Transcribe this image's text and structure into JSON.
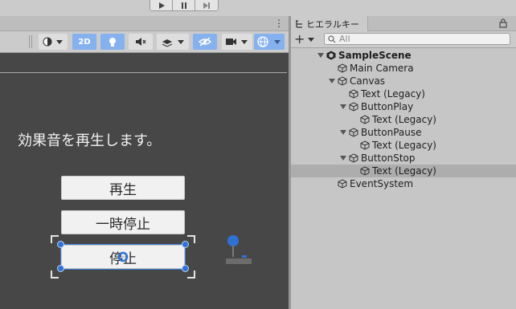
{
  "playbar": {
    "buttons": [
      "play-icon",
      "pause-icon",
      "step-icon"
    ]
  },
  "scene": {
    "toolbar": {
      "mode_2d": "2D"
    },
    "canvas_text": "効果音を再生します。",
    "buttons": [
      {
        "label": "再生"
      },
      {
        "label": "一時停止"
      },
      {
        "label": "停止"
      }
    ]
  },
  "hierarchy": {
    "tab_label": "ヒエラルキー",
    "search_placeholder": "All",
    "items": [
      {
        "label": "SampleScene",
        "depth": 0,
        "expanded": true,
        "bold": true,
        "icon": "unity-scene-icon"
      },
      {
        "label": "Main Camera",
        "depth": 1,
        "expanded": null,
        "icon": "gameobject-icon"
      },
      {
        "label": "Canvas",
        "depth": 1,
        "expanded": true,
        "icon": "gameobject-icon"
      },
      {
        "label": "Text (Legacy)",
        "depth": 2,
        "expanded": null,
        "icon": "gameobject-icon"
      },
      {
        "label": "ButtonPlay",
        "depth": 2,
        "expanded": true,
        "icon": "gameobject-icon"
      },
      {
        "label": "Text (Legacy)",
        "depth": 3,
        "expanded": null,
        "icon": "gameobject-icon"
      },
      {
        "label": "ButtonPause",
        "depth": 2,
        "expanded": true,
        "icon": "gameobject-icon"
      },
      {
        "label": "Text (Legacy)",
        "depth": 3,
        "expanded": null,
        "icon": "gameobject-icon"
      },
      {
        "label": "ButtonStop",
        "depth": 2,
        "expanded": true,
        "icon": "gameobject-icon"
      },
      {
        "label": "Text (Legacy)",
        "depth": 3,
        "expanded": null,
        "selected": true,
        "icon": "gameobject-icon"
      },
      {
        "label": "EventSystem",
        "depth": 1,
        "expanded": null,
        "icon": "gameobject-icon"
      }
    ]
  },
  "colors": {
    "scene_bg": "#474747",
    "toggle_on": "#86b1ef",
    "selection": "#2f72d6",
    "hierarchy_bg": "#c6c6c6"
  }
}
